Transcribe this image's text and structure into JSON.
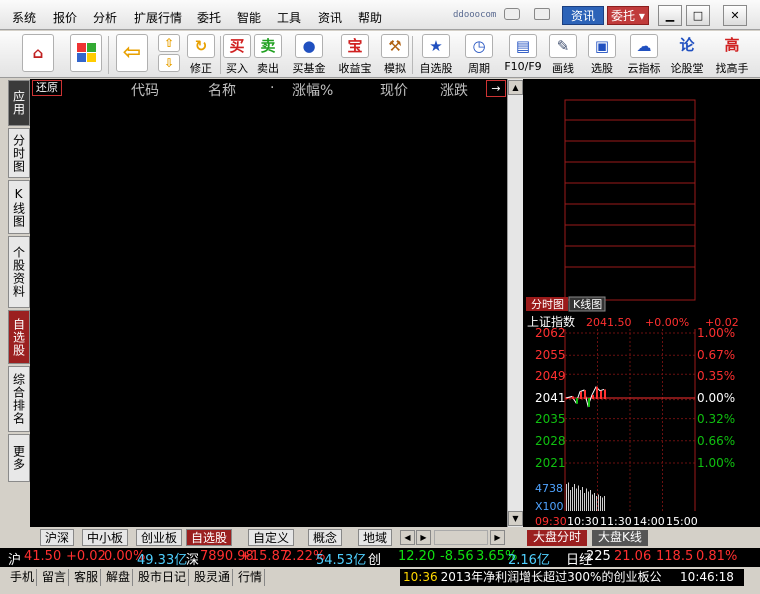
{
  "menu": {
    "items": [
      "系统",
      "报价",
      "分析",
      "扩展行情",
      "委托",
      "智能",
      "工具",
      "资讯",
      "帮助"
    ],
    "brand": "ddooocom",
    "news_button": "资讯",
    "trade_button": "委托",
    "min_icon": "minimize-icon",
    "max_icon": "maximize-icon",
    "close_icon": "close-icon"
  },
  "toolbar": {
    "home_icon": "home-icon",
    "windows_icon": "windows-logo-icon",
    "back_icon": "back-arrow-icon",
    "fix_label": "修正",
    "buy_icon_text": "买",
    "buy_label": "买入",
    "sell_icon_text": "卖",
    "sell_label": "卖出",
    "fund_label": "买基金",
    "yield_icon_text": "宝",
    "yield_label": "收益宝",
    "sim_label": "模拟",
    "watchlist_label": "自选股",
    "period_label": "周期",
    "f10_label": "F10/F9",
    "draw_label": "画线",
    "pick_label": "选股",
    "cloud_label": "云指标",
    "forum_icon_text": "论",
    "forum_label": "论股堂",
    "expert_icon_text": "高",
    "expert_label": "找高手"
  },
  "left_tabs": [
    "应用",
    "分时图",
    "K线图",
    "个股资料",
    "自选股",
    "综合排名",
    "更多"
  ],
  "grid": {
    "restore": "还原",
    "headers": [
      "代码",
      "名称",
      "·",
      "涨幅%",
      "现价",
      "涨跌"
    ],
    "arrow": "→"
  },
  "bottom_tabs": [
    "沪深",
    "中小板",
    "创业板",
    "自选股",
    "自定义",
    "概念",
    "地域"
  ],
  "chart": {
    "tabs": [
      "分时图",
      "K线图"
    ],
    "index_name": "上证指数",
    "index_value": "2041.50",
    "index_change_pct": "+0.00%",
    "index_change": "+0.02",
    "y_left": [
      "2062",
      "2055",
      "2049",
      "2041",
      "2035",
      "2028",
      "2021"
    ],
    "y_right": [
      "1.00%",
      "0.67%",
      "0.35%",
      "0.00%",
      "0.32%",
      "0.66%",
      "1.00%"
    ],
    "vol_top": "4738",
    "vol_mult": "X100",
    "times": [
      "09:30",
      "10:30",
      "11:30",
      "14:00",
      "15:00"
    ],
    "bottom_tabs": [
      "大盘分时",
      "大盘K线"
    ],
    "line_points": [
      [
        0,
        2041.5
      ],
      [
        6,
        2042
      ],
      [
        10,
        2040
      ],
      [
        14,
        2043.5
      ],
      [
        18,
        2044
      ],
      [
        22,
        2039
      ],
      [
        26,
        2042.5
      ],
      [
        30,
        2045
      ],
      [
        34,
        2043.8
      ],
      [
        38,
        2044.2
      ]
    ],
    "red_color": "#ff3030",
    "green_color": "#10c010"
  },
  "ticker": {
    "sh_label": "沪",
    "sh_value": "41.50",
    "sh_change": "+0.02",
    "sh_pct": "0.00%",
    "sh_amount": "49.33亿",
    "sz_label": "深",
    "sz_value": "7890.98",
    "sz_change": "+15.87",
    "sz_pct": "2.22%",
    "sz_amount": "54.53亿",
    "cy_label": "创",
    "cy_value": "12.20",
    "cy_change": "-8.56",
    "cy_pct": "3.65%",
    "cy_amount": "2.16亿",
    "rj_label": "日经",
    "rj_value": "225",
    "rj_value2": "21.06",
    "rj_change": "118.5",
    "rj_pct": "0.81%"
  },
  "status": {
    "items": [
      "手机",
      "留言",
      "客服",
      "解盘",
      "股市日记",
      "股灵通",
      "行情"
    ],
    "news_time": "10:36",
    "news_text": "2013年净利润增长超过300%的创业板公",
    "clock": "10:46:18"
  }
}
